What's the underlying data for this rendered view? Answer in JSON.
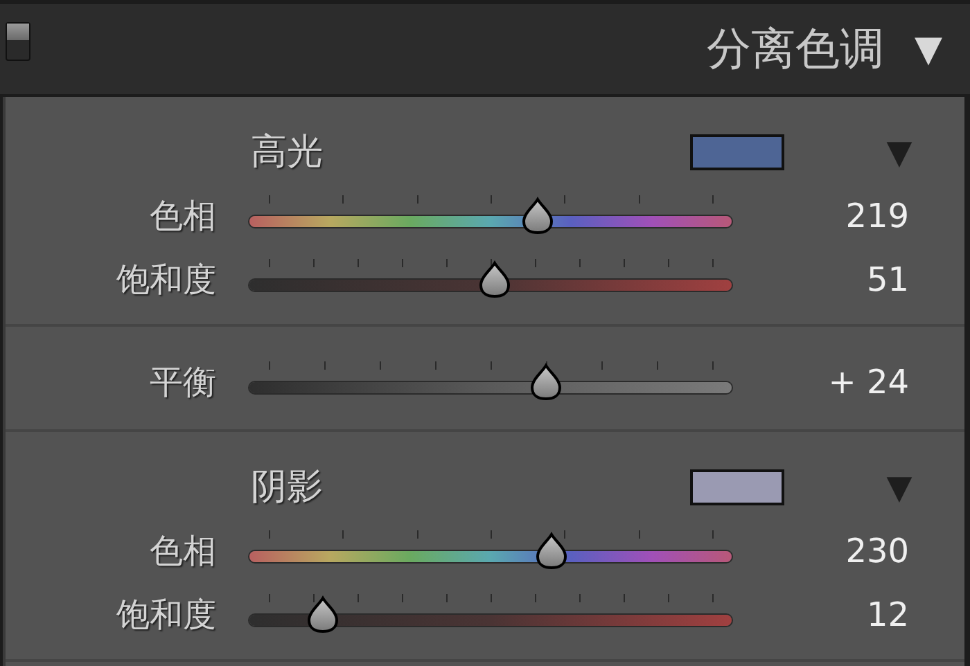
{
  "panel": {
    "enabled": true,
    "title": "分离色调",
    "collapse_icon": "▼"
  },
  "sections": [
    {
      "kind": "tone",
      "title": "高光",
      "color": "#4e6595",
      "menu_icon": "▼",
      "sliders": [
        {
          "kind": "hue",
          "label": "色相",
          "level": 0.598,
          "reading": "219"
        },
        {
          "kind": "saturation",
          "label": "饱和度",
          "level": 0.509,
          "reading": "51"
        }
      ]
    },
    {
      "kind": "balance",
      "sliders": [
        {
          "kind": "balance",
          "label": "平衡",
          "level": 0.615,
          "reading": "+ 24"
        }
      ]
    },
    {
      "kind": "tone",
      "title": "阴影",
      "color": "#9a9ab2",
      "menu_icon": "▼",
      "sliders": [
        {
          "kind": "hue",
          "label": "色相",
          "level": 0.626,
          "reading": "230"
        },
        {
          "kind": "saturation",
          "label": "饱和度",
          "level": 0.152,
          "reading": "12"
        }
      ]
    }
  ]
}
